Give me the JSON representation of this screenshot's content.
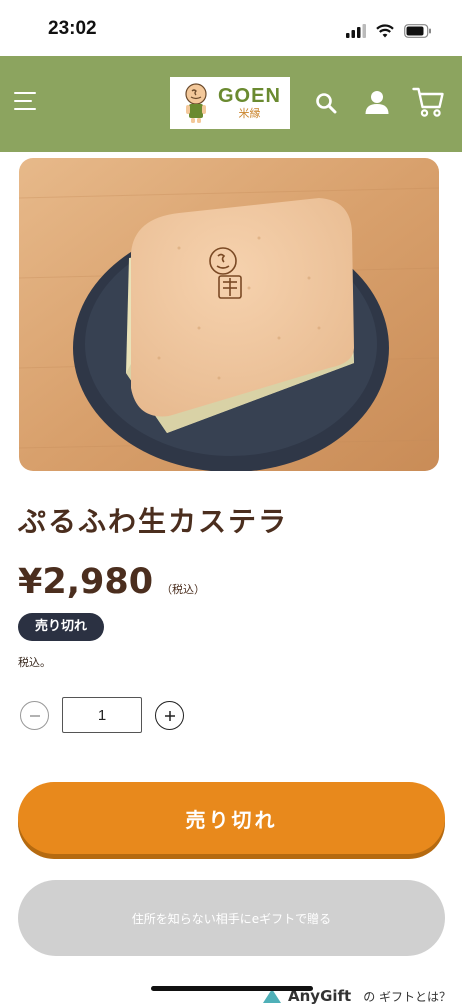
{
  "status_bar": {
    "time": "23:02"
  },
  "header": {
    "logo": {
      "brand": "GOEN",
      "sub": "米縁"
    },
    "background": "#8ca45f"
  },
  "icons": {
    "menu": "hamburger-menu-icon",
    "search": "search-icon",
    "account": "user-icon",
    "cart": "cart-icon"
  },
  "product": {
    "title": "ぷるふわ生カステラ",
    "price": "¥2,980",
    "tax_label": "（税込）",
    "badge": "売り切れ",
    "tax_note": "税込。",
    "quantity": "1"
  },
  "buttons": {
    "sold_out": "売り切れ",
    "gift": "住所を知らない相手にeギフトで贈る"
  },
  "anygift": {
    "name": "AnyGift",
    "question": "の ギフトとは？"
  },
  "colors": {
    "accent": "#e8891c",
    "badge": "#2b3142",
    "text": "#4b2e1e"
  }
}
